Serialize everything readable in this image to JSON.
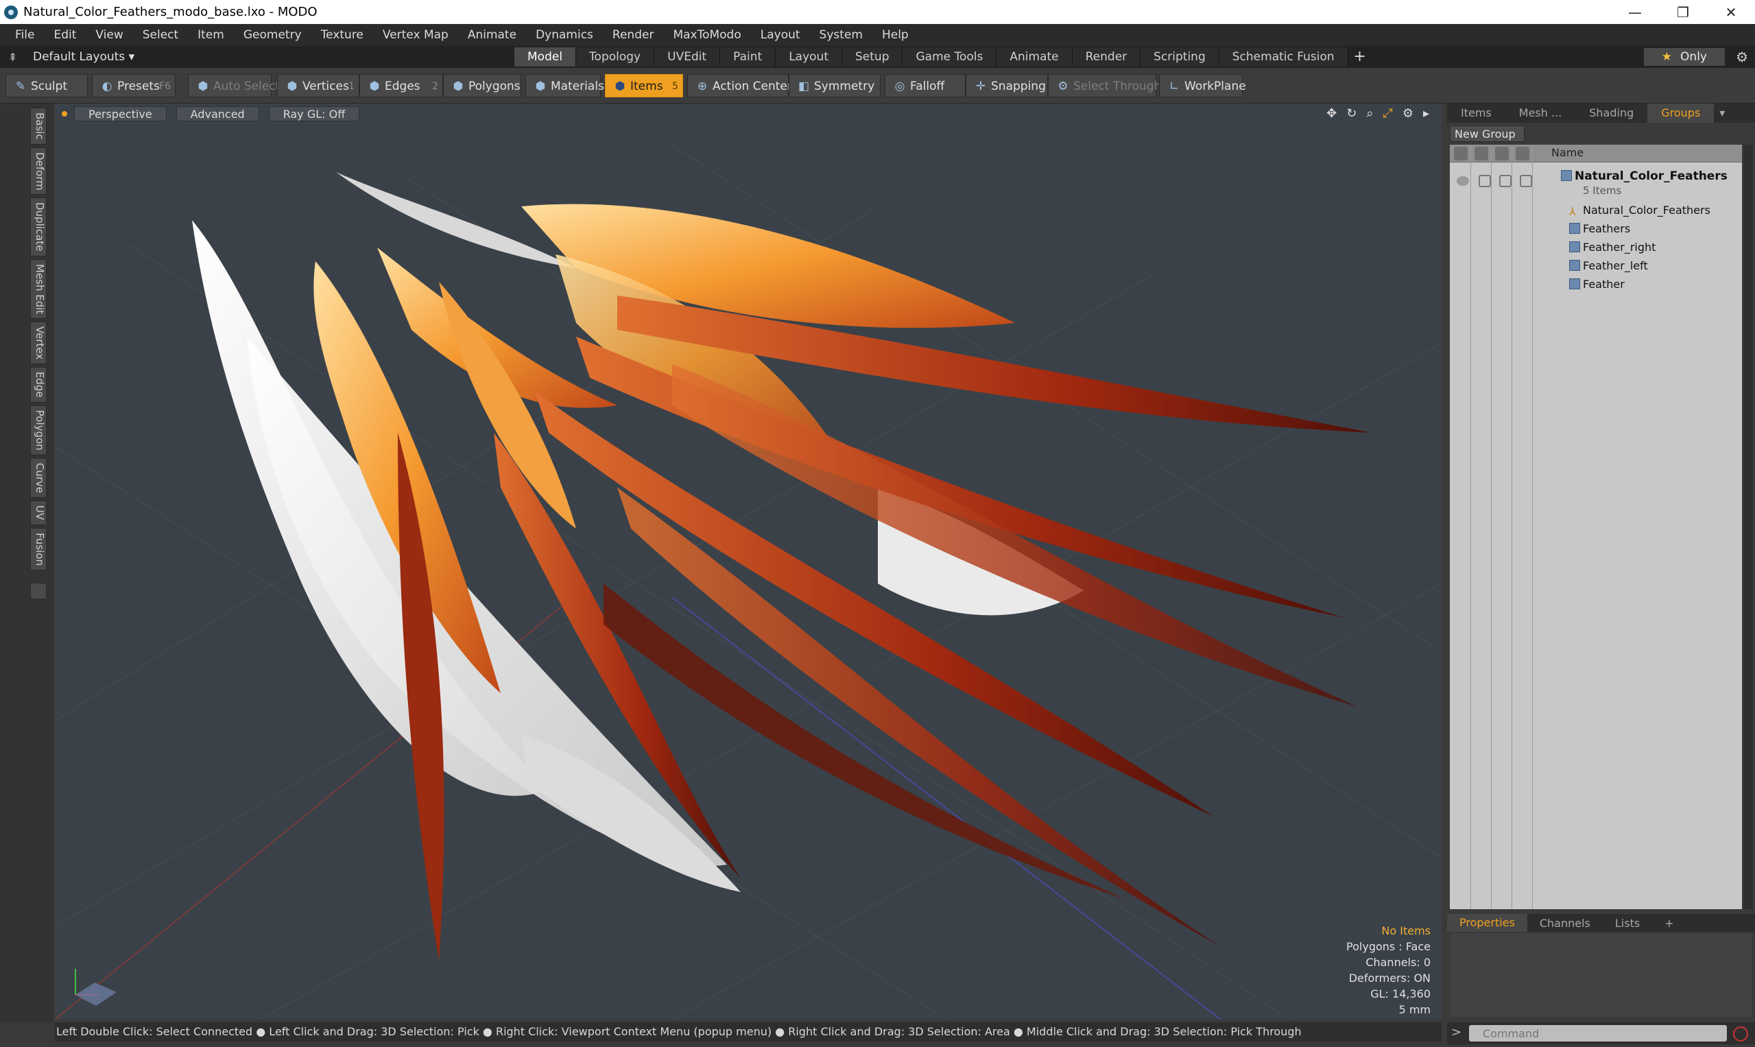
{
  "window": {
    "title": "Natural_Color_Feathers_modo_base.lxo - MODO",
    "minimize": "—",
    "restore": "❐",
    "close": "✕"
  },
  "menu": [
    "File",
    "Edit",
    "View",
    "Select",
    "Item",
    "Geometry",
    "Texture",
    "Vertex Map",
    "Animate",
    "Dynamics",
    "Render",
    "MaxToModo",
    "Layout",
    "System",
    "Help"
  ],
  "layouts": {
    "dropdown": "Default Layouts ▾",
    "tabs": [
      "Model",
      "Topology",
      "UVEdit",
      "Paint",
      "Layout",
      "Setup",
      "Game Tools",
      "Animate",
      "Render",
      "Scripting",
      "Schematic Fusion"
    ],
    "active_tab": "Model",
    "add_tab": "+",
    "only_label": "Only"
  },
  "toolbar": {
    "sculpt": "Sculpt",
    "presets": "Presets",
    "presets_key": "F6",
    "auto_select": "Auto Select",
    "vertices": "Vertices",
    "vertices_key": "1",
    "edges": "Edges",
    "edges_key": "2",
    "polygons": "Polygons",
    "materials": "Materials",
    "items": "Items",
    "items_key": "5",
    "action_center": "Action Center",
    "symmetry": "Symmetry",
    "falloff": "Falloff",
    "snapping": "Snapping",
    "select_through": "Select Through",
    "workplane": "WorkPlane"
  },
  "left_tabs": [
    "Basic",
    "Deform",
    "Duplicate",
    "Mesh Edit",
    "Vertex",
    "Edge",
    "Polygon",
    "Curve",
    "UV",
    "Fusion"
  ],
  "viewport": {
    "view": "Perspective",
    "shading": "Advanced",
    "raygl": "Ray GL: Off",
    "stats": {
      "no_items": "No Items",
      "polygons": "Polygons : Face",
      "channels": "Channels: 0",
      "deformers": "Deformers: ON",
      "gl": "GL: 14,360",
      "unit": "5 mm"
    }
  },
  "right_panel": {
    "tabs": [
      "Items",
      "Mesh ...",
      "Shading",
      "Groups"
    ],
    "active_tab": "Groups",
    "new_group": "New Group",
    "name_header": "Name",
    "group": {
      "name": "Natural_Color_Feathers",
      "count": "5 Items",
      "children": [
        "Natural_Color_Feathers",
        "Feathers",
        "Feather_right",
        "Feather_left",
        "Feather"
      ]
    },
    "bottom_tabs": [
      "Properties",
      "Channels",
      "Lists",
      "+"
    ],
    "bottom_active": "Properties"
  },
  "statusbar": {
    "hint": "Left Double Click: Select Connected ● Left Click and Drag: 3D Selection: Pick ● Right Click: Viewport Context Menu (popup menu) ● Right Click and Drag: 3D Selection: Area ● Middle Click and Drag: 3D Selection: Pick Through"
  },
  "command": {
    "placeholder": "Command"
  }
}
